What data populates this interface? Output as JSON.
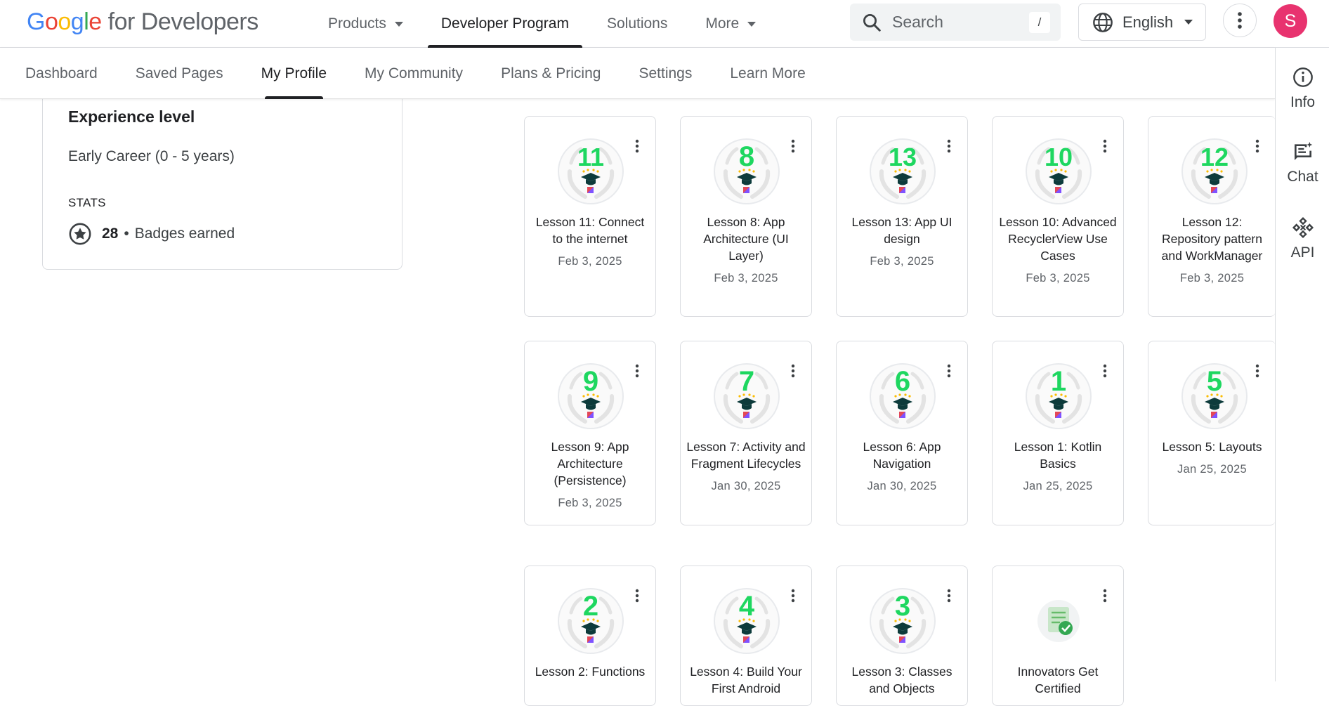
{
  "header": {
    "logo_google": "Google",
    "logo_rest": " for Developers",
    "nav": [
      {
        "label": "Products",
        "caret": true,
        "active": false
      },
      {
        "label": "Developer Program",
        "caret": false,
        "active": true
      },
      {
        "label": "Solutions",
        "caret": false,
        "active": false
      },
      {
        "label": "More",
        "caret": true,
        "active": false
      }
    ],
    "search_placeholder": "Search",
    "search_shortcut": "/",
    "language": "English",
    "avatar_initial": "S",
    "avatar_color": "#e8336f"
  },
  "subnav": [
    {
      "label": "Dashboard",
      "active": false
    },
    {
      "label": "Saved Pages",
      "active": false
    },
    {
      "label": "My Profile",
      "active": true
    },
    {
      "label": "My Community",
      "active": false
    },
    {
      "label": "Plans & Pricing",
      "active": false
    },
    {
      "label": "Settings",
      "active": false
    },
    {
      "label": "Learn More",
      "active": false
    }
  ],
  "right_rail": [
    {
      "label": "Info",
      "icon": "info-icon"
    },
    {
      "label": "Chat",
      "icon": "chat-icon"
    },
    {
      "label": "API",
      "icon": "api-icon"
    }
  ],
  "profile": {
    "experience_label": "Experience level",
    "experience_value": "Early Career (0 - 5 years)",
    "stats_label": "STATS",
    "badges_count": "28",
    "badges_separator": "•",
    "badges_label": "Badges earned"
  },
  "badges": [
    {
      "number": "11",
      "title": "Lesson 11: Connect to the internet",
      "date": "Feb 3, 2025",
      "type": "lesson"
    },
    {
      "number": "8",
      "title": "Lesson 8: App Architecture (UI Layer)",
      "date": "Feb 3, 2025",
      "type": "lesson"
    },
    {
      "number": "13",
      "title": "Lesson 13: App UI design",
      "date": "Feb 3, 2025",
      "type": "lesson"
    },
    {
      "number": "10",
      "title": "Lesson 10: Advanced RecyclerView Use Cases",
      "date": "Feb 3, 2025",
      "type": "lesson"
    },
    {
      "number": "12",
      "title": "Lesson 12: Repository pattern and WorkManager",
      "date": "Feb 3, 2025",
      "type": "lesson"
    },
    {
      "number": "9",
      "title": "Lesson 9: App Architecture (Persistence)",
      "date": "Feb 3, 2025",
      "type": "lesson"
    },
    {
      "number": "7",
      "title": "Lesson 7: Activity and Fragment Lifecycles",
      "date": "Jan 30, 2025",
      "type": "lesson"
    },
    {
      "number": "6",
      "title": "Lesson 6: App Navigation",
      "date": "Jan 30, 2025",
      "type": "lesson"
    },
    {
      "number": "1",
      "title": "Lesson 1: Kotlin Basics",
      "date": "Jan 25, 2025",
      "type": "lesson"
    },
    {
      "number": "5",
      "title": "Lesson 5: Layouts",
      "date": "Jan 25, 2025",
      "type": "lesson"
    },
    {
      "number": "2",
      "title": "Lesson 2: Functions",
      "date": "",
      "type": "lesson"
    },
    {
      "number": "4",
      "title": "Lesson 4: Build Your First Android",
      "date": "",
      "type": "lesson"
    },
    {
      "number": "3",
      "title": "Lesson 3: Classes and Objects",
      "date": "",
      "type": "lesson"
    },
    {
      "number": "",
      "title": "Innovators Get Certified",
      "date": "",
      "type": "certified"
    }
  ],
  "colors": {
    "badge_number": "#1ed760",
    "badge_ring": "#f1f3f4"
  }
}
